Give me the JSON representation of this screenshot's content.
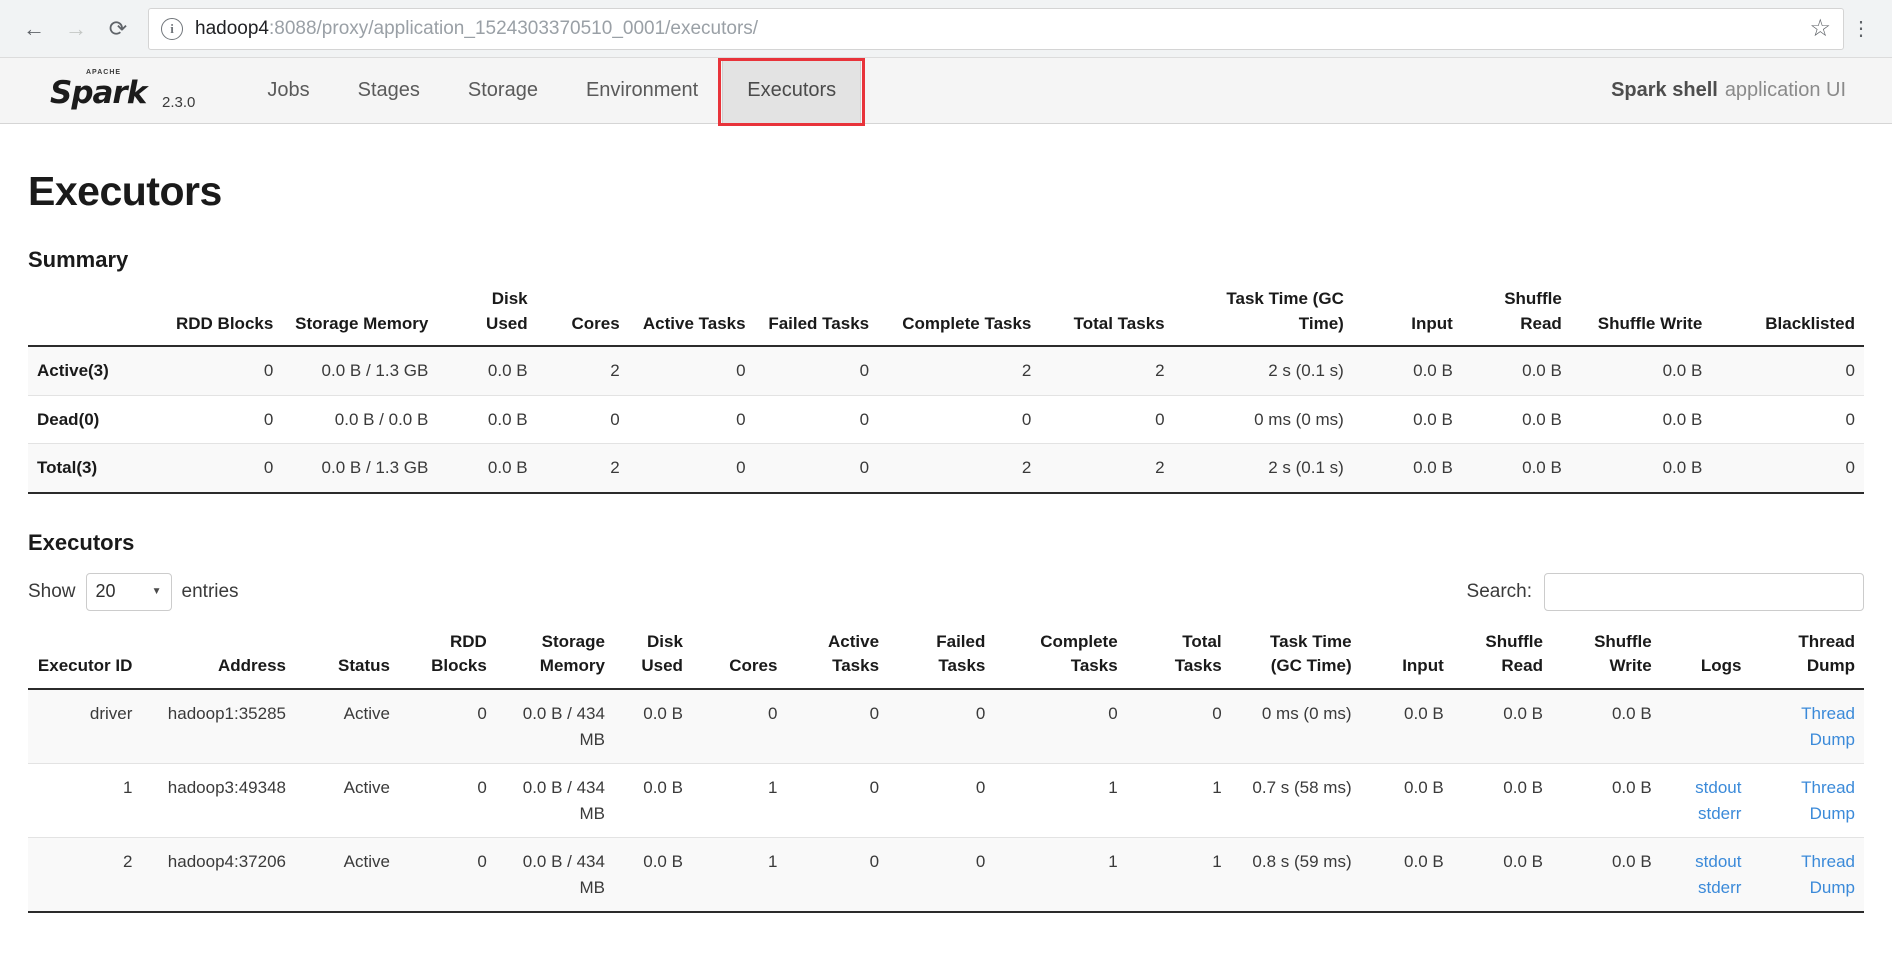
{
  "browser": {
    "back_icon": "←",
    "forward_icon": "→",
    "reload_icon": "⟳",
    "info_icon": "i",
    "url_host": "hadoop4",
    "url_path": ":8088/proxy/application_1524303370510_0001/executors/",
    "star_icon": "☆",
    "menu_icon": "⋮"
  },
  "navbar": {
    "logo_apache": "APACHE",
    "logo_spark": "Spark",
    "version": "2.3.0",
    "tabs": [
      {
        "label": "Jobs",
        "active": false
      },
      {
        "label": "Stages",
        "active": false
      },
      {
        "label": "Storage",
        "active": false
      },
      {
        "label": "Environment",
        "active": false
      },
      {
        "label": "Executors",
        "active": true
      }
    ],
    "app_title_bold": "Spark shell",
    "app_title_rest": "application UI"
  },
  "page": {
    "title": "Executors",
    "summary_heading": "Summary",
    "executors_heading": "Executors"
  },
  "summary": {
    "headers": [
      "",
      "RDD Blocks",
      "Storage Memory",
      "Disk Used",
      "Cores",
      "Active Tasks",
      "Failed Tasks",
      "Complete Tasks",
      "Total Tasks",
      "Task Time (GC Time)",
      "Input",
      "Shuffle Read",
      "Shuffle Write",
      "Blacklisted"
    ],
    "rows": [
      {
        "label": "Active(3)",
        "rdd_blocks": "0",
        "storage_memory": "0.0 B / 1.3 GB",
        "disk_used": "0.0 B",
        "cores": "2",
        "active_tasks": "0",
        "failed_tasks": "0",
        "complete_tasks": "2",
        "total_tasks": "2",
        "task_time": "2 s (0.1 s)",
        "input": "0.0 B",
        "shuffle_read": "0.0 B",
        "shuffle_write": "0.0 B",
        "blacklisted": "0"
      },
      {
        "label": "Dead(0)",
        "rdd_blocks": "0",
        "storage_memory": "0.0 B / 0.0 B",
        "disk_used": "0.0 B",
        "cores": "0",
        "active_tasks": "0",
        "failed_tasks": "0",
        "complete_tasks": "0",
        "total_tasks": "0",
        "task_time": "0 ms (0 ms)",
        "input": "0.0 B",
        "shuffle_read": "0.0 B",
        "shuffle_write": "0.0 B",
        "blacklisted": "0"
      },
      {
        "label": "Total(3)",
        "rdd_blocks": "0",
        "storage_memory": "0.0 B / 1.3 GB",
        "disk_used": "0.0 B",
        "cores": "2",
        "active_tasks": "0",
        "failed_tasks": "0",
        "complete_tasks": "2",
        "total_tasks": "2",
        "task_time": "2 s (0.1 s)",
        "input": "0.0 B",
        "shuffle_read": "0.0 B",
        "shuffle_write": "0.0 B",
        "blacklisted": "0"
      }
    ]
  },
  "controls": {
    "show_label": "Show",
    "entries_value": "20",
    "entries_label": "entries",
    "caret_icon": "▼",
    "search_label": "Search:",
    "search_value": "",
    "search_placeholder": ""
  },
  "executors": {
    "headers": [
      "Executor ID",
      "Address",
      "Status",
      "RDD Blocks",
      "Storage Memory",
      "Disk Used",
      "Cores",
      "Active Tasks",
      "Failed Tasks",
      "Complete Tasks",
      "Total Tasks",
      "Task Time (GC Time)",
      "Input",
      "Shuffle Read",
      "Shuffle Write",
      "Logs",
      "Thread Dump"
    ],
    "rows": [
      {
        "id": "driver",
        "address": "hadoop1:35285",
        "status": "Active",
        "rdd_blocks": "0",
        "storage_memory": "0.0 B / 434 MB",
        "disk_used": "0.0 B",
        "cores": "0",
        "active_tasks": "0",
        "failed_tasks": "0",
        "complete_tasks": "0",
        "total_tasks": "0",
        "task_time": "0 ms (0 ms)",
        "input": "0.0 B",
        "shuffle_read": "0.0 B",
        "shuffle_write": "0.0 B",
        "log_stdout": "",
        "log_stderr": "",
        "thread_dump": "Thread Dump"
      },
      {
        "id": "1",
        "address": "hadoop3:49348",
        "status": "Active",
        "rdd_blocks": "0",
        "storage_memory": "0.0 B / 434 MB",
        "disk_used": "0.0 B",
        "cores": "1",
        "active_tasks": "0",
        "failed_tasks": "0",
        "complete_tasks": "1",
        "total_tasks": "1",
        "task_time": "0.7 s (58 ms)",
        "input": "0.0 B",
        "shuffle_read": "0.0 B",
        "shuffle_write": "0.0 B",
        "log_stdout": "stdout",
        "log_stderr": "stderr",
        "thread_dump": "Thread Dump"
      },
      {
        "id": "2",
        "address": "hadoop4:37206",
        "status": "Active",
        "rdd_blocks": "0",
        "storage_memory": "0.0 B / 434 MB",
        "disk_used": "0.0 B",
        "cores": "1",
        "active_tasks": "0",
        "failed_tasks": "0",
        "complete_tasks": "1",
        "total_tasks": "1",
        "task_time": "0.8 s (59 ms)",
        "input": "0.0 B",
        "shuffle_read": "0.0 B",
        "shuffle_write": "0.0 B",
        "log_stdout": "stdout",
        "log_stderr": "stderr",
        "thread_dump": "Thread Dump"
      }
    ]
  },
  "colors": {
    "link": "#3b8ad9",
    "highlight": "#e8333a",
    "logo_star": "#e8703a"
  }
}
